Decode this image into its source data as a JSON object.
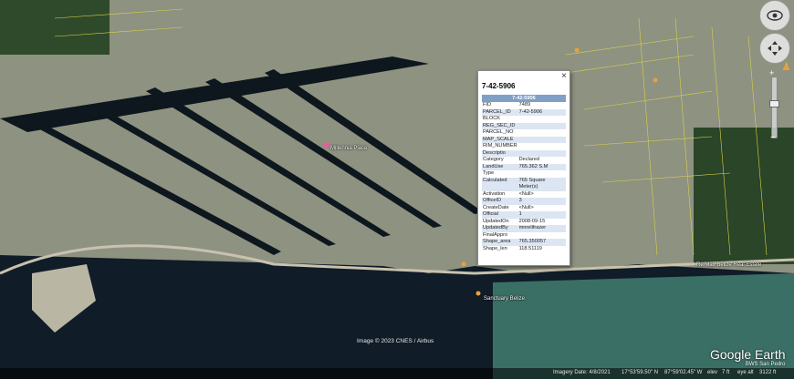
{
  "map": {
    "labels": [
      {
        "text": "Millennia Place"
      },
      {
        "text": "Re/Max Belize Real Estate"
      },
      {
        "text": "Sanctuary Belize"
      }
    ]
  },
  "popup": {
    "title": "7-42-5906",
    "header": "7-42-5906",
    "close": "×",
    "rows": [
      {
        "k": "FID",
        "v": "7489"
      },
      {
        "k": "PARCEL_ID",
        "v": "7-42-5906"
      },
      {
        "k": "BLOCK",
        "v": ""
      },
      {
        "k": "REG_SEC_ID",
        "v": ""
      },
      {
        "k": "PARCEL_NO",
        "v": ""
      },
      {
        "k": "MAP_SCALE",
        "v": ""
      },
      {
        "k": "RIM_NUMBER",
        "v": ""
      },
      {
        "k": "Descriptio",
        "v": ""
      },
      {
        "k": "Category",
        "v": "Declared"
      },
      {
        "k": "LandUse",
        "v": "765.362 S.M"
      },
      {
        "k": "Type",
        "v": ""
      },
      {
        "k": "Calculated",
        "v": "765 Square Meter(s)"
      },
      {
        "k": "Activation",
        "v": "<Null>"
      },
      {
        "k": "OfficeID",
        "v": "3"
      },
      {
        "k": "CreateDate",
        "v": "<Null>"
      },
      {
        "k": "Official",
        "v": "1"
      },
      {
        "k": "UpdatedOn",
        "v": "2008-09-15"
      },
      {
        "k": "UpdatedBy",
        "v": "mnrelifrazer"
      },
      {
        "k": "FinalAppro",
        "v": ""
      },
      {
        "k": "Shape_area",
        "v": "765.350057"
      },
      {
        "k": "Shape_len",
        "v": "118.51119"
      }
    ]
  },
  "footer": {
    "credit": "Image © 2023 CNES / Airbus",
    "logo": "Google Earth",
    "logo_sub": "BWS San Pedro",
    "imagery_date": "Imagery Date: 4/8/2021",
    "lat": "17°53'59.50\" N",
    "lon": "87°59'02.45\" W",
    "elev": "elev",
    "elev_val": "7 ft",
    "eye_alt": "eye alt",
    "eye_val": "3122 ft"
  },
  "colors": {
    "water": "#101c27",
    "lagoon": "#3a6f65",
    "land": "#a8a89c",
    "veg": "#2f4a2a",
    "parcel_line": "#d8d24a"
  },
  "icons": [
    "eye-icon",
    "pan-icon",
    "zoom-plus-icon",
    "zoom-minus-icon",
    "pegman-icon",
    "close-icon",
    "pin-icon"
  ]
}
